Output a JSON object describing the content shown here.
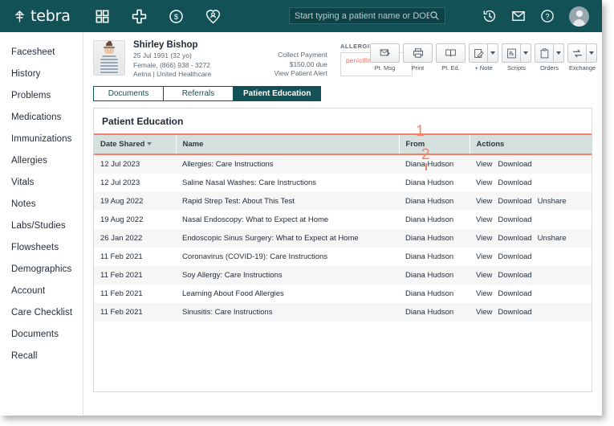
{
  "topbar": {
    "brand": "tebra",
    "nav_icons": [
      "grid-icon",
      "plus-icon",
      "dollar-circle-icon",
      "patient-locator-icon"
    ],
    "search": {
      "placeholder": "Start typing a patient name or DOB",
      "value": ""
    },
    "right_icons": [
      "history-clock-icon",
      "envelope-icon",
      "help-question-icon",
      "user-avatar-icon"
    ]
  },
  "sidebar": {
    "items": [
      {
        "label": "Facesheet"
      },
      {
        "label": "History"
      },
      {
        "label": "Problems"
      },
      {
        "label": "Medications"
      },
      {
        "label": "Immunizations"
      },
      {
        "label": "Allergies"
      },
      {
        "label": "Vitals"
      },
      {
        "label": "Notes"
      },
      {
        "label": "Labs/Studies"
      },
      {
        "label": "Flowsheets"
      },
      {
        "label": "Demographics"
      },
      {
        "label": "Account"
      },
      {
        "label": "Care Checklist"
      },
      {
        "label": "Documents"
      },
      {
        "label": "Recall"
      }
    ]
  },
  "patient": {
    "name": "Shirley Bishop",
    "dob_age": "25 Jul 1991 (32 yo)",
    "sex_phone": "Female, (866) 938 - 3272",
    "insurance": "Aetna | United Healthcare",
    "collect_payment": "Collect Payment",
    "amount_due": "$150.00 due",
    "view_alert": "View Patient Alert",
    "allergies_label": "ALLERGIES",
    "allergies_value": "penicillin"
  },
  "toolbar": {
    "buttons": [
      {
        "label": "Pt. Msg",
        "icon": "patient-message-icon",
        "split": false
      },
      {
        "label": "Print",
        "icon": "printer-icon",
        "split": false
      },
      {
        "label": "Pt. Ed.",
        "icon": "book-icon",
        "split": false
      },
      {
        "label": "+ Note",
        "icon": "note-pencil-icon",
        "split": true
      },
      {
        "label": "Scripts",
        "icon": "prescription-rx-icon",
        "split": true
      },
      {
        "label": "Orders",
        "icon": "clipboard-icon",
        "split": true
      },
      {
        "label": "Exchange",
        "icon": "exchange-arrows-icon",
        "split": true
      }
    ]
  },
  "tabs": [
    {
      "label": "Documents",
      "active": false
    },
    {
      "label": "Referrals",
      "active": false
    },
    {
      "label": "Patient Education",
      "active": true
    }
  ],
  "card": {
    "title": "Patient Education",
    "columns": [
      "Date Shared",
      "Name",
      "From",
      "Actions"
    ],
    "sorted_column": "Date Shared",
    "rows": [
      {
        "date": "12 Jul 2023",
        "name": "Allergies: Care Instructions",
        "from": "Diana Hudson",
        "actions": [
          "View",
          "Download"
        ]
      },
      {
        "date": "12 Jul 2023",
        "name": "Saline Nasal Washes: Care Instructions",
        "from": "Diana Hudson",
        "actions": [
          "View",
          "Download"
        ]
      },
      {
        "date": "19 Aug 2022",
        "name": "Rapid Strep Test: About This Test",
        "from": "Diana Hudson",
        "actions": [
          "View",
          "Download",
          "Unshare"
        ]
      },
      {
        "date": "19 Aug 2022",
        "name": "Nasal Endoscopy: What to Expect at Home",
        "from": "Diana Hudson",
        "actions": [
          "View",
          "Download"
        ]
      },
      {
        "date": "26 Jan 2022",
        "name": "Endoscopic Sinus Surgery: What to Expect at Home",
        "from": "Diana Hudson",
        "actions": [
          "View",
          "Download",
          "Unshare"
        ]
      },
      {
        "date": "11 Feb 2021",
        "name": "Coronavirus (COVID-19): Care Instructions",
        "from": "Diana Hudson",
        "actions": [
          "View",
          "Download"
        ]
      },
      {
        "date": "11 Feb 2021",
        "name": "Soy Allergy: Care Instructions",
        "from": "Diana Hudson",
        "actions": [
          "View",
          "Download"
        ]
      },
      {
        "date": "11 Feb 2021",
        "name": "Learning About Food Allergies",
        "from": "Diana Hudson",
        "actions": [
          "View",
          "Download"
        ]
      },
      {
        "date": "11 Feb 2021",
        "name": "Sinusitis: Care Instructions",
        "from": "Diana Hudson",
        "actions": [
          "View",
          "Download"
        ]
      }
    ]
  },
  "annotations": [
    {
      "number": "1"
    },
    {
      "number": "2"
    }
  ],
  "colors": {
    "brand_teal": "#125257",
    "annotation_coral": "#f4806b",
    "table_header_bg": "#d6e0dd",
    "allergy_text": "#e3796d"
  }
}
